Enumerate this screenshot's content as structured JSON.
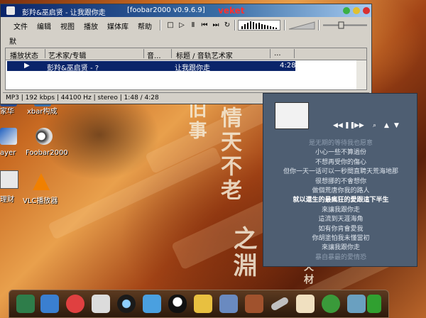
{
  "window": {
    "title": "彭羚&巫启贤 - 让我跟你走",
    "app_name": "[foobar2000 v0.9.6.9]",
    "brand": "veket"
  },
  "menu": [
    "文件",
    "编辑",
    "视图",
    "播放",
    "媒体库",
    "帮助"
  ],
  "toolbar_icons": [
    "stop-icon",
    "play-icon",
    "pause-icon",
    "previous-icon",
    "next-icon",
    "random-icon"
  ],
  "tabs": [
    "默认"
  ],
  "playlist": {
    "columns": [
      "播放状态",
      "艺术家/专辑",
      "音...",
      "标题 / 音轨艺术家",
      "..."
    ],
    "rows": [
      {
        "status": "▶",
        "artist_album": "彭羚&巫启贤 - ?",
        "track": "",
        "title": "让我跟你走",
        "length": "4:28"
      }
    ]
  },
  "status_bar": "MP3 | 192 kbps | 44100 Hz | stereo | 1:48 / 4:28",
  "lyrics": {
    "lines": [
      "是无期的等待我也愿意",
      "小心一些不算過份",
      "不想再受你的傷心",
      "但你一天一话可以一秒間直聘天荒海地那",
      "很想挪的不會想你",
      "做個荒唐你我的路人",
      "就以還生的最瘋狂的愛跟這下半生",
      "來讓我跟你走",
      "這流到天涯海角",
      "如有你肯會愛我",
      "你胡塗怕我未懂當初",
      "來讓我跟你走",
      "暴自暴最的愛情恐"
    ],
    "current_index": 6
  },
  "desktop_icons": [
    {
      "label": "家华",
      "icon": "app-icon"
    },
    {
      "label": "xbar构成",
      "icon": "app-icon"
    },
    {
      "label": "ayer",
      "icon": "media-icon"
    },
    {
      "label": "Foobar2000",
      "icon": "foobar-icon"
    },
    {
      "label": "理财",
      "icon": "calculator-icon"
    },
    {
      "label": "VLC播放器",
      "icon": "vlc-icon"
    }
  ],
  "calligraphy": [
    "旧事",
    "情天不老",
    "之淵",
    "天材"
  ],
  "dock_icons": [
    "monitor-icon",
    "computer-icon",
    "pig-icon",
    "terminal-icon",
    "record-icon",
    "people-icon",
    "penguin-icon",
    "folder-icon",
    "image-icon",
    "archive-icon",
    "pen-icon",
    "image2-icon",
    "tree-icon",
    "game-icon",
    "face-icon"
  ],
  "colors": {
    "title_start": "#0a246a",
    "selection": "#0a246a",
    "brand": "#ff3030",
    "lyrics_panel": "#4e5e72"
  }
}
